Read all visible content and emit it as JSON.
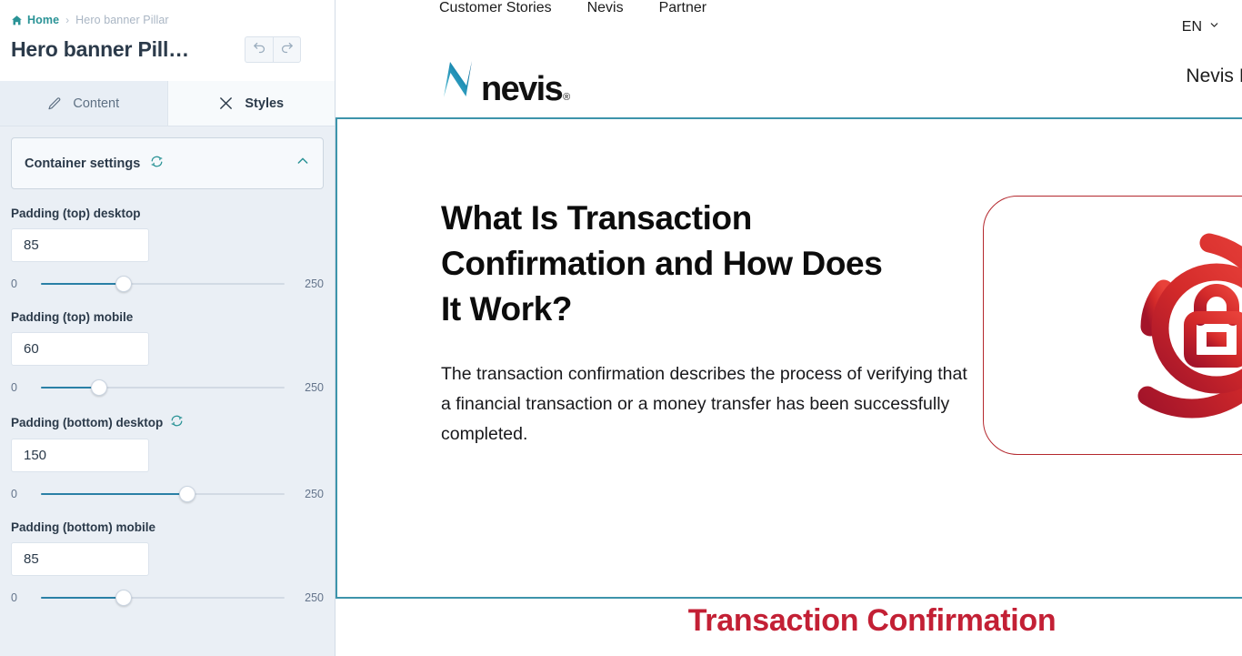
{
  "sidebar": {
    "breadcrumb": {
      "home_label": "Home",
      "separator": "›",
      "current_label": "Hero banner Pillar",
      "home_icon": "home-icon"
    },
    "page_title": "Hero banner Pill…",
    "history": {
      "undo_icon": "undo-icon",
      "redo_icon": "redo-icon"
    },
    "tabs": [
      {
        "label": "Content",
        "icon": "pencil-icon",
        "active": false
      },
      {
        "label": "Styles",
        "icon": "styles-cross-icon",
        "active": true
      }
    ],
    "accordion": {
      "title": "Container settings",
      "reset_icon": "reset-refresh-icon",
      "chevron_icon": "chevron-up-icon",
      "expanded": true
    },
    "fields": [
      {
        "label": "Padding (top) desktop",
        "value": "85",
        "has_reset": false,
        "min": "0",
        "max": "250",
        "min_num": 0,
        "max_num": 250,
        "value_num": 85
      },
      {
        "label": "Padding (top) mobile",
        "value": "60",
        "has_reset": false,
        "min": "0",
        "max": "250",
        "min_num": 0,
        "max_num": 250,
        "value_num": 60
      },
      {
        "label": "Padding (bottom) desktop",
        "value": "150",
        "has_reset": true,
        "reset_icon": "reset-refresh-icon",
        "min": "0",
        "max": "250",
        "min_num": 0,
        "max_num": 250,
        "value_num": 150
      },
      {
        "label": "Padding (bottom) mobile",
        "value": "85",
        "has_reset": false,
        "min": "0",
        "max": "250",
        "min_num": 0,
        "max_num": 250,
        "value_num": 85
      }
    ]
  },
  "preview": {
    "topnav": [
      "Customer Stories",
      "Nevis",
      "Partner"
    ],
    "language": {
      "label": "EN",
      "chevron_icon": "chevron-down-icon"
    },
    "logo": {
      "mark_icon": "nevis-n-logo-icon",
      "word": "nevis",
      "registered": "®"
    },
    "product_name": "Nevis Identity Su",
    "hero": {
      "heading": "What Is Transaction Confirmation and How Does It Work?",
      "subtext": "The transaction confirmation describes the process of verifying that a financial transaction or a money transfer has been successfully completed.",
      "card_icon": "transaction-lock-shield-icon"
    },
    "bottom_title": "Transaction Confirmation"
  },
  "colors": {
    "accent_teal": "#2a9396",
    "slider_blue": "#2a80a6",
    "selection_border": "#3d94ab",
    "brand_red": "#c32035",
    "card_border_red": "#b4282e",
    "sidebar_bg": "#eaeff5",
    "text_dark": "#2b3a4a"
  }
}
